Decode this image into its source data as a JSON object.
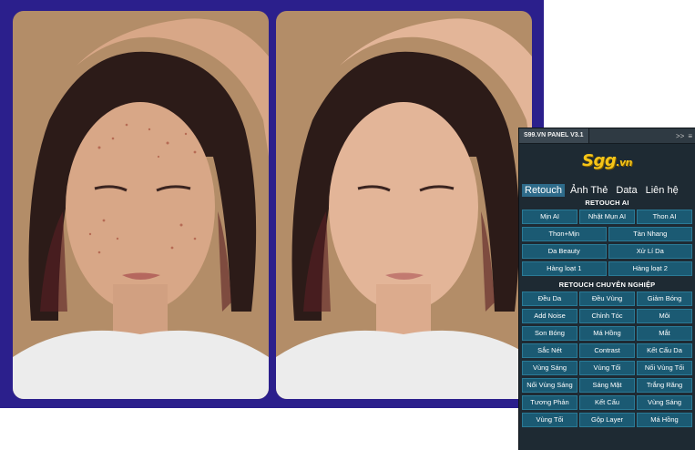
{
  "panel": {
    "title": "S99.VN PANEL V3.1",
    "controls": {
      "collapse": ">>",
      "menu": "≡"
    },
    "logo": {
      "main": "Sgg",
      "suffix": ".vn"
    },
    "tabs": [
      "Retouch",
      "Ảnh Thẻ",
      "Data",
      "Liên hệ"
    ],
    "active_tab": "Retouch",
    "retouch_ai": {
      "title": "RETOUCH AI",
      "rows": [
        [
          "Mịn AI",
          "Nhặt Mụn AI",
          "Thon AI"
        ],
        [
          "Thon+Mịn",
          "Tàn Nhang"
        ],
        [
          "Da Beauty",
          "Xử Lí Da"
        ],
        [
          "Hàng loạt 1",
          "Hàng loạt 2"
        ]
      ]
    },
    "retouch_pro": {
      "title": "RETOUCH CHUYÊN NGHIỆP",
      "rows": [
        [
          "Đều Da",
          "Đều Vùng",
          "Giảm Bóng"
        ],
        [
          "Add Noise",
          "Chỉnh Tóc",
          "Môi"
        ],
        [
          "Son Bóng",
          "Má Hồng",
          "Mắt"
        ],
        [
          "Sắc Nét",
          "Contrast",
          "Kết Cấu Da"
        ],
        [
          "Vùng Sáng",
          "Vùng Tối",
          "Nối Vùng Tối"
        ],
        [
          "Nối Vùng Sáng",
          "Sáng Mặt",
          "Trắng Răng"
        ],
        [
          "Tương Phản",
          "Kết Cấu",
          "Vùng Sáng"
        ],
        [
          "Vùng Tối",
          "Gộp Layer",
          "Má Hồng"
        ]
      ]
    }
  },
  "colors": {
    "background_frame": "#2b1f8c",
    "panel_bg": "#1e2a33",
    "button_bg": "#1b5a73",
    "logo": "#f6c518",
    "active_tab": "#2e6b8a"
  }
}
